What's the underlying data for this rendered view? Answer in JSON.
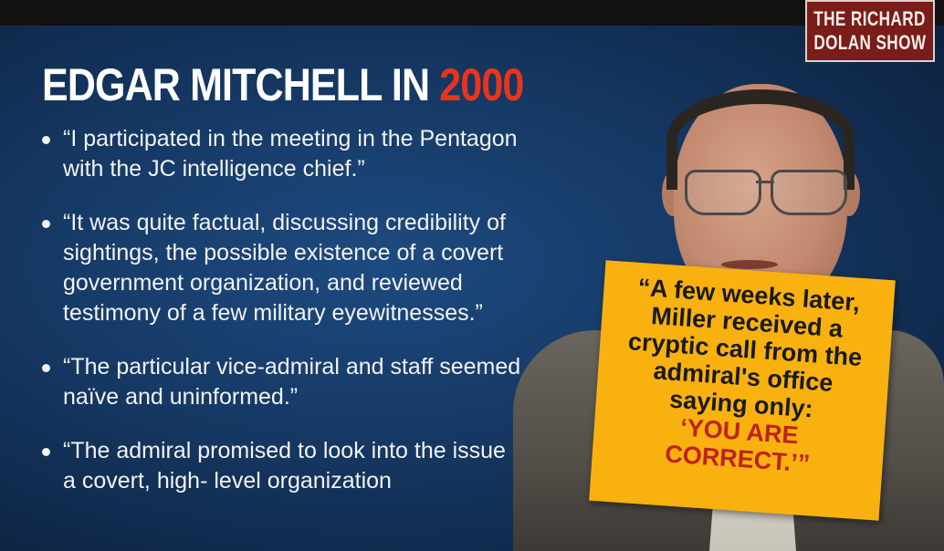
{
  "slide": {
    "title_main": "EDGAR MITCHELL IN ",
    "title_year": "2000",
    "bullets": [
      "“I participated in the meeting in the Pentagon with the JC intelligence chief.”",
      "“It was quite factual, discussing credibility of sightings, the possible existence of a covert government organization, and reviewed testimony of a few military eyewitnesses.”",
      "“The particular vice-admiral and staff seemed naïve and uninformed.”",
      "“The admiral promised to look into the issue of a covert, high- level organization"
    ]
  },
  "show_tag": {
    "line1": "THE RICHARD",
    "line2": "DOLAN SHOW"
  },
  "quote": {
    "lines": [
      "“A few weeks later,",
      "Miller received a",
      "cryptic call from the",
      "admiral's office",
      "saying only:"
    ],
    "highlight_lines": [
      "‘YOU ARE",
      "CORRECT.’”"
    ]
  },
  "colors": {
    "year_accent": "#e8341c",
    "quote_box": "#f8b10f",
    "quote_highlight": "#c0211a",
    "tag_background": "#7a1c1a"
  }
}
